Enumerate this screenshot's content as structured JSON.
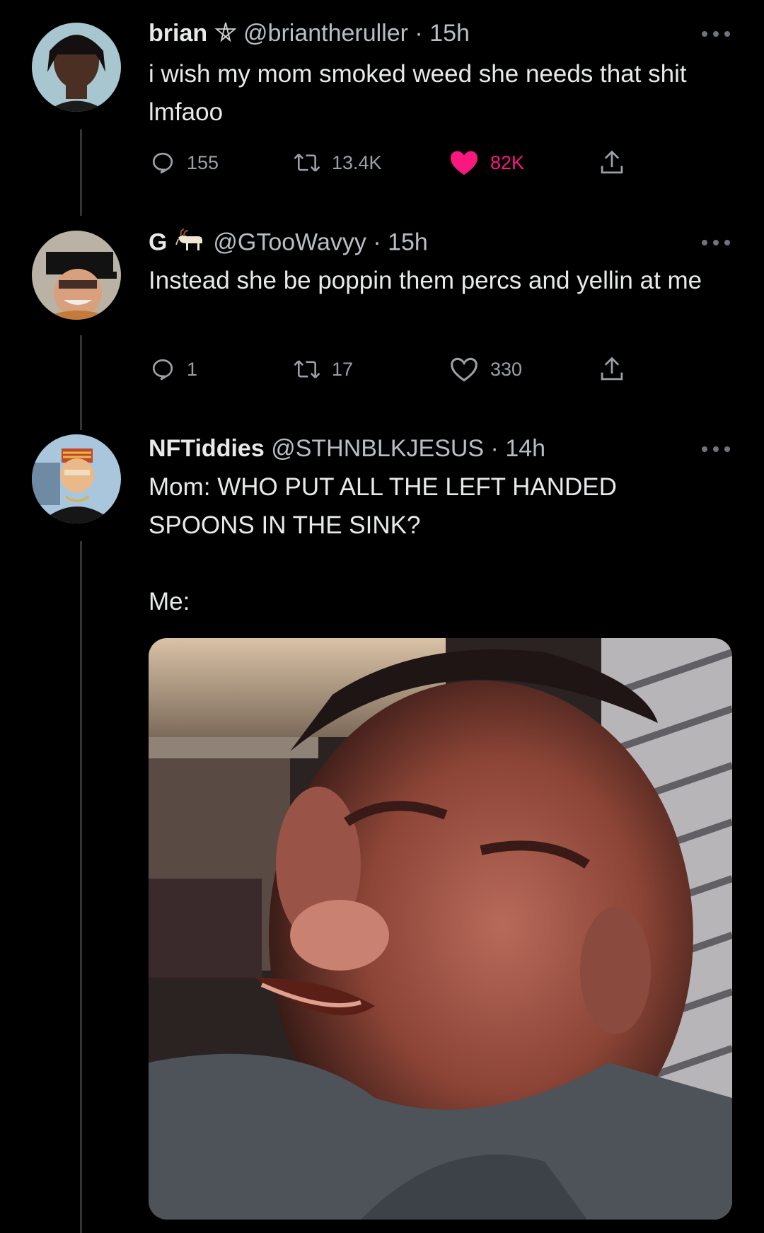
{
  "tweets": [
    {
      "name": "brian",
      "handle": "@briantheruller",
      "sep": " · ",
      "time": "15h",
      "text": "i wish my mom smoked weed she needs that shit lmfaoo",
      "replies": "155",
      "retweets": "13.4K",
      "likes": "82K",
      "liked": true
    },
    {
      "name": "G",
      "handle": "@GTooWavyy",
      "sep": " · ",
      "time": "15h",
      "text": "Instead she be poppin them percs and yellin at me",
      "replies": "1",
      "retweets": "17",
      "likes": "330",
      "liked": false
    },
    {
      "name": "NFTiddies",
      "handle": "@STHNBLKJESUS",
      "sep": " · ",
      "time": "14h",
      "text_line1": "Mom: WHO PUT ALL THE LEFT HANDED SPOONS IN THE SINK?",
      "text_line2": "Me:"
    }
  ],
  "colors": {
    "background": "#000000",
    "like": "#f91880",
    "muted": "#9aa0a6",
    "thread_line": "#333639"
  },
  "icons": [
    "pentagram-icon",
    "goat-emoji-icon",
    "reply-icon",
    "retweet-icon",
    "heart-icon",
    "share-icon",
    "more-icon"
  ]
}
